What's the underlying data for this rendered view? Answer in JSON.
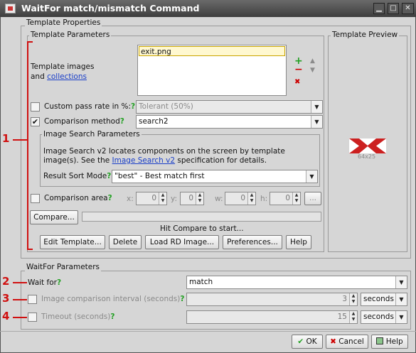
{
  "window": {
    "title": "WaitFor match/mismatch Command",
    "controls": [
      "minimize-icon",
      "maximize-icon",
      "close-icon"
    ]
  },
  "template_properties": {
    "legend": "Template Properties",
    "params_legend": "Template Parameters",
    "images_label": "Template images",
    "and": "and",
    "collections_link": "collections",
    "image_list": [
      "exit.png"
    ],
    "add_icon": "+",
    "remove_icon": "−",
    "delete_icon": "✖",
    "up_icon": "▲",
    "down_icon": "▼",
    "custom_pass_rate_label": "Custom pass rate in %:",
    "custom_pass_rate_value": "Tolerant (50%)",
    "comparison_method_label": "Comparison method",
    "comparison_method_value": "search2",
    "q": "?",
    "image_search_legend": "Image Search Parameters",
    "image_search_desc_1": "Image Search v2 locates components on the screen by template",
    "image_search_desc_2a": "image(s). See the ",
    "image_search_link": "Image Search v2",
    "image_search_desc_2b": " specification for details.",
    "result_sort_label": "Result Sort Mode",
    "result_sort_value": "\"best\" - Best match first",
    "comparison_area_label": "Comparison area",
    "x_label": "x:",
    "y_label": "y:",
    "w_label": "w:",
    "h_label": "h:",
    "x_value": "0",
    "y_value": "0",
    "w_value": "0",
    "h_value": "0",
    "ellipsis_button": "...",
    "compare_button": "Compare...",
    "status_text": "Hit Compare to start...",
    "edit_template_button": "Edit Template...",
    "delete_button": "Delete",
    "load_rd_button": "Load RD Image...",
    "preferences_button": "Preferences...",
    "help_button": "Help",
    "preview_legend": "Template Preview",
    "preview_size": "64x25"
  },
  "waitfor": {
    "legend": "WaitFor Parameters",
    "wait_for_label": "Wait for",
    "wait_for_value": "match",
    "interval_label": "Image comparison interval (seconds)",
    "interval_value": "3",
    "interval_unit": "seconds",
    "timeout_label": "Timeout (seconds)",
    "timeout_value": "15",
    "timeout_unit": "seconds"
  },
  "footer": {
    "ok": "OK",
    "cancel": "Cancel",
    "help": "Help"
  },
  "annotations": {
    "n1": "1",
    "n2": "2",
    "n3": "3",
    "n4": "4",
    "color": "#d01010"
  }
}
